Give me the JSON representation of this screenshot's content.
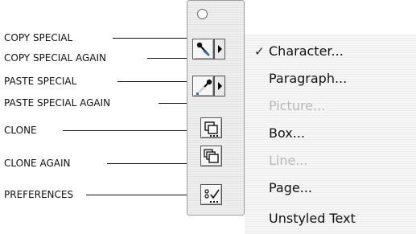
{
  "labels": {
    "copy_special": "COPY SPECIAL",
    "copy_special_again": "COPY SPECIAL AGAIN",
    "paste_special": "PASTE SPECIAL",
    "paste_special_again": "PASTE SPECIAL AGAIN",
    "clone": "CLONE",
    "clone_again": "CLONE AGAIN",
    "preferences": "PREFERENCES"
  },
  "palette": {
    "tools": [
      {
        "name": "copy-special-tool",
        "icon": "eyedropper-copy-icon"
      },
      {
        "name": "paste-special-tool",
        "icon": "eyedropper-paste-icon"
      },
      {
        "name": "clone-tool",
        "icon": "clone-icon"
      },
      {
        "name": "clone-again-tool",
        "icon": "clone-again-icon"
      },
      {
        "name": "preferences-tool",
        "icon": "preferences-icon"
      }
    ]
  },
  "menu": {
    "items": [
      {
        "label": "Character...",
        "checked": true,
        "enabled": true
      },
      {
        "label": "Paragraph...",
        "checked": false,
        "enabled": true
      },
      {
        "label": "Picture...",
        "checked": false,
        "enabled": false
      },
      {
        "label": "Box...",
        "checked": false,
        "enabled": true
      },
      {
        "label": "Line...",
        "checked": false,
        "enabled": false
      },
      {
        "label": "Page...",
        "checked": false,
        "enabled": true
      },
      {
        "label": "Unstyled Text",
        "checked": false,
        "enabled": true
      }
    ],
    "check_glyph": "✓"
  },
  "colors": {
    "disabled_text": "#b8b8b8",
    "accent_blue": "#2a6fd6"
  }
}
